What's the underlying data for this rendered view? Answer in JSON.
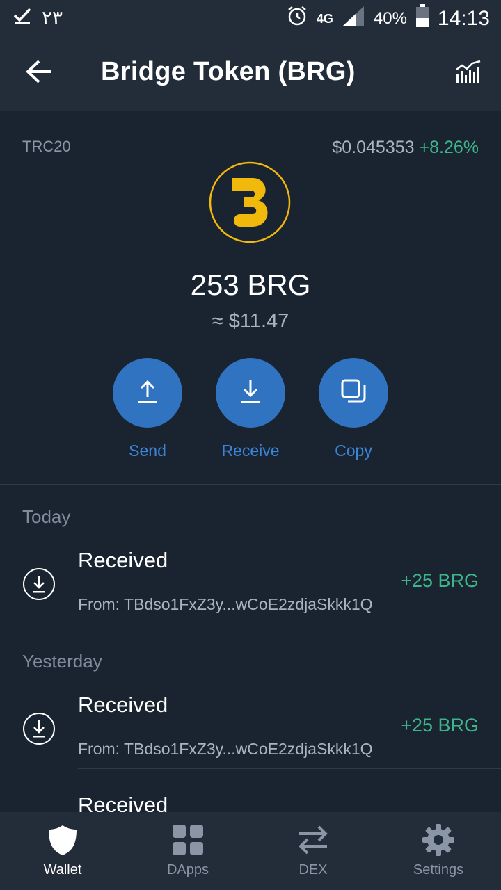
{
  "status_bar": {
    "left_text": "۲۳",
    "network": "4G",
    "battery": "40%",
    "time": "14:13"
  },
  "app_bar": {
    "title": "Bridge Token (BRG)",
    "back_icon": "back-arrow-icon",
    "chart_icon": "chart-icon"
  },
  "token": {
    "network": "TRC20",
    "price": "$0.045353",
    "change": "+8.26%",
    "balance": "253 BRG",
    "fiat_value": "≈ $11.47"
  },
  "actions": [
    {
      "label": "Send",
      "icon": "send-icon"
    },
    {
      "label": "Receive",
      "icon": "receive-icon"
    },
    {
      "label": "Copy",
      "icon": "copy-icon"
    }
  ],
  "transactions": {
    "today_label": "Today",
    "yesterday_label": "Yesterday",
    "items": [
      {
        "type": "Received",
        "from": "From: TBdso1FxZ3y...wCoE2zdjaSkkk1Q",
        "amount": "+25 BRG"
      },
      {
        "type": "Received",
        "from": "From: TBdso1FxZ3y...wCoE2zdjaSkkk1Q",
        "amount": "+25 BRG"
      },
      {
        "type": "Received"
      }
    ]
  },
  "bottom_nav": [
    {
      "label": "Wallet",
      "icon": "shield-icon",
      "active": true
    },
    {
      "label": "DApps",
      "icon": "grid-icon"
    },
    {
      "label": "DEX",
      "icon": "swap-icon"
    },
    {
      "label": "Settings",
      "icon": "gear-icon"
    }
  ],
  "colors": {
    "background": "#1a2330",
    "bar": "#232d3a",
    "accent": "#2f73c1",
    "positive": "#3db58a",
    "logo": "#f0b90b"
  }
}
